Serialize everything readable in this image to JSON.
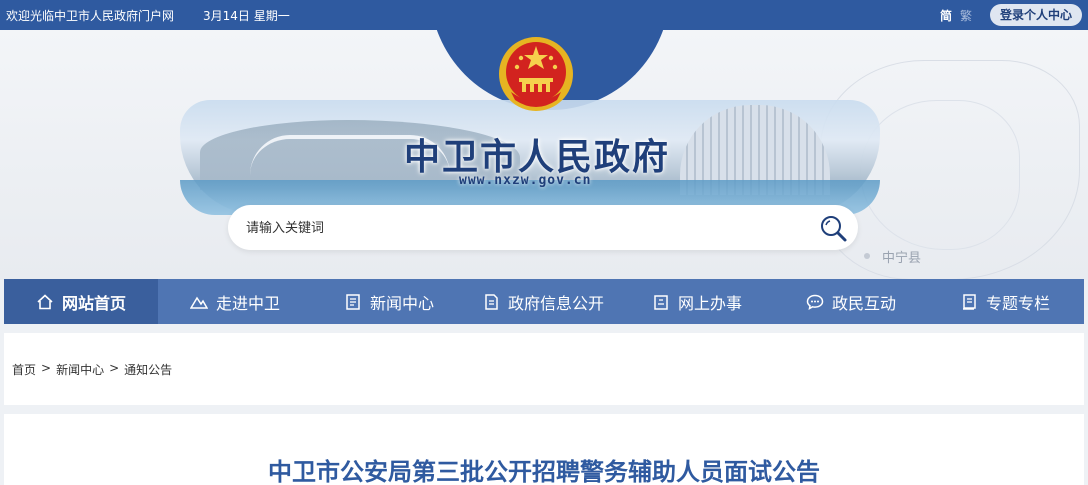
{
  "topbar": {
    "welcome": "欢迎光临中卫市人民政府门户网",
    "date": "3月14日 星期一",
    "lang_simplified": "简",
    "lang_traditional": "繁",
    "login": "登录个人中心"
  },
  "banner": {
    "title": "中卫市人民政府",
    "url": "www.nxzw.gov.cn",
    "map_label": "中宁县"
  },
  "search": {
    "placeholder": "请输入关键词"
  },
  "nav": {
    "items": [
      {
        "label": "网站首页",
        "icon": "home-icon"
      },
      {
        "label": "走进中卫",
        "icon": "mountain-icon"
      },
      {
        "label": "新闻中心",
        "icon": "news-icon"
      },
      {
        "label": "政府信息公开",
        "icon": "document-icon"
      },
      {
        "label": "网上办事",
        "icon": "edit-icon"
      },
      {
        "label": "政民互动",
        "icon": "chat-icon"
      },
      {
        "label": "专题专栏",
        "icon": "book-icon"
      }
    ]
  },
  "breadcrumb": {
    "home": "首页",
    "level1": "新闻中心",
    "level2": "通知公告",
    "separator": ">"
  },
  "article": {
    "title": "中卫市公安局第三批公开招聘警务辅助人员面试公告"
  },
  "colors": {
    "primary": "#2f5aa0",
    "nav": "#4f75b3",
    "nav_active": "#3a5f9d"
  }
}
